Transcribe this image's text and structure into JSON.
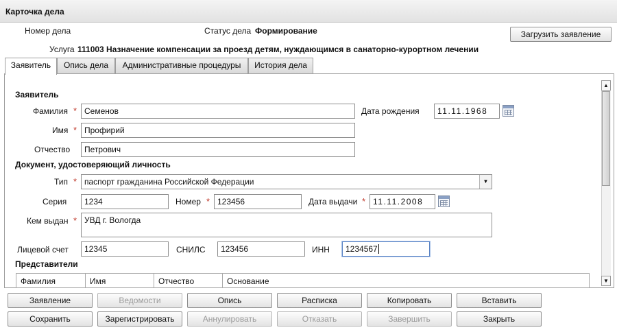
{
  "window": {
    "title": "Карточка дела"
  },
  "header": {
    "case_number_label": "Номер дела",
    "status_label": "Статус дела",
    "status_value": "Формирование",
    "upload_button": "Загрузить заявление",
    "service_label": "Услуга",
    "service_value": "111003 Назначение  компенсации за проезд детям, нуждающимся в санаторно-курортном лечении"
  },
  "tabs": [
    {
      "label": "Заявитель",
      "active": true
    },
    {
      "label": "Опись дела",
      "active": false
    },
    {
      "label": "Административные процедуры",
      "active": false
    },
    {
      "label": "История дела",
      "active": false
    }
  ],
  "form": {
    "section_applicant": "Заявитель",
    "surname_label": "Фамилия",
    "surname_value": "Семенов",
    "birthdate_label": "Дата рождения",
    "birthdate_value": "11.11.1968",
    "name_label": "Имя",
    "name_value": "Профирий",
    "patronymic_label": "Отчество",
    "patronymic_value": "Петрович",
    "section_document": "Документ, удостоверяющий личность",
    "doc_type_label": "Тип",
    "doc_type_value": "паспорт гражданина Российской Федерации",
    "series_label": "Серия",
    "series_value": "1234",
    "number_label": "Номер",
    "number_value": "123456",
    "issue_date_label": "Дата выдачи",
    "issue_date_value": "11.11.2008",
    "issued_by_label": "Кем выдан",
    "issued_by_value": "УВД г. Вологда",
    "account_label": "Лицевой счет",
    "account_value": "12345",
    "snils_label": "СНИЛС",
    "snils_value": "123456",
    "inn_label": "ИНН",
    "inn_value": "1234567",
    "required_mark": "*",
    "section_representatives": "Представители",
    "rep_columns": [
      "Фамилия",
      "Имя",
      "Отчество",
      "Основание"
    ]
  },
  "buttons_row1": [
    {
      "label": "Заявление",
      "enabled": true
    },
    {
      "label": "Ведомости",
      "enabled": false
    },
    {
      "label": "Опись",
      "enabled": true
    },
    {
      "label": "Расписка",
      "enabled": true
    },
    {
      "label": "Копировать",
      "enabled": true
    },
    {
      "label": "Вставить",
      "enabled": true
    }
  ],
  "buttons_row2": [
    {
      "label": "Сохранить",
      "enabled": true
    },
    {
      "label": "Зарегистрировать",
      "enabled": true
    },
    {
      "label": "Аннулировать",
      "enabled": false
    },
    {
      "label": "Отказать",
      "enabled": false
    },
    {
      "label": "Завершить",
      "enabled": false
    },
    {
      "label": "Закрыть",
      "enabled": true
    }
  ],
  "colors": {
    "required": "#c0392b",
    "focus_border": "#5b84c4",
    "disabled_text": "#9a9a9a"
  }
}
